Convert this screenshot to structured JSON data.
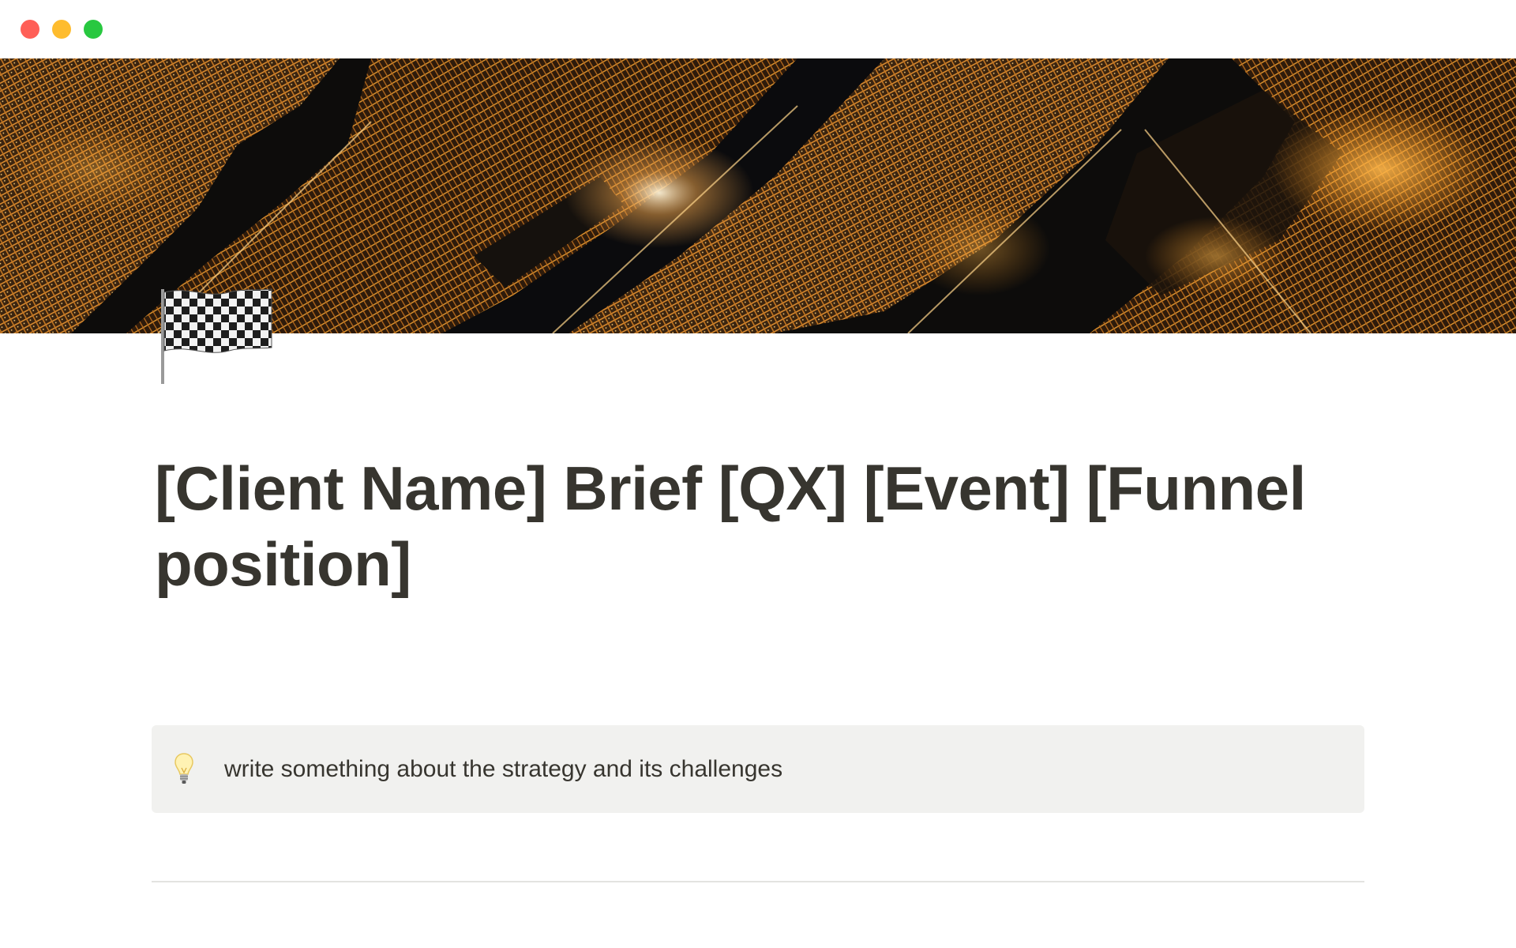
{
  "window": {
    "controls": {
      "close_color": "#ff5f57",
      "minimize_color": "#febc2e",
      "zoom_color": "#28c840"
    }
  },
  "page": {
    "cover": "city-at-night-aerial-photo",
    "icon": "checkered-flag-icon",
    "title": "[Client Name] Brief [QX] [Event] [Funnel position]",
    "callout": {
      "icon": "light-bulb-icon",
      "text": "write something about the strategy and its challenges",
      "background": "#f1f1ef"
    },
    "text_color": "#37352f"
  }
}
